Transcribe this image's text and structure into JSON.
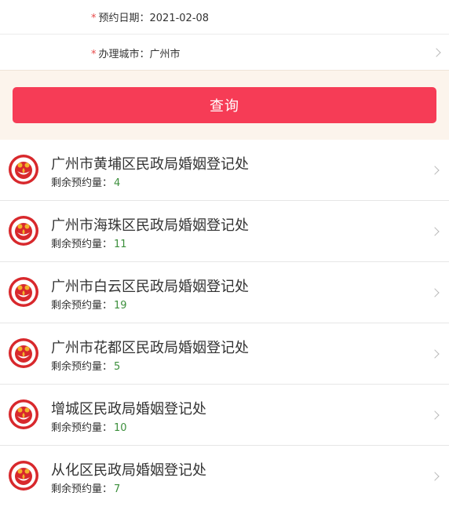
{
  "form": {
    "date_label": "预约日期：",
    "date_value": "2021-02-08",
    "city_label": "办理城市：",
    "city_value": "广州市",
    "required_mark": "*"
  },
  "query_button": {
    "label": "查询"
  },
  "offices": {
    "remaining_label": "剩余预约量：",
    "items": [
      {
        "name": "广州市黄埔区民政局婚姻登记处",
        "remaining": "4"
      },
      {
        "name": "广州市海珠区民政局婚姻登记处",
        "remaining": "11"
      },
      {
        "name": "广州市白云区民政局婚姻登记处",
        "remaining": "19"
      },
      {
        "name": "广州市花都区民政局婚姻登记处",
        "remaining": "5"
      },
      {
        "name": "增城区民政局婚姻登记处",
        "remaining": "10"
      },
      {
        "name": "从化区民政局婚姻登记处",
        "remaining": "7"
      }
    ]
  },
  "colors": {
    "accent": "#f63c56",
    "required": "#e84a4a",
    "count": "#3c8f3c",
    "panel_bg": "#fcf4ec"
  },
  "icons": {
    "logo": "marriage-registry-logo-icon",
    "chevron": "chevron-right-icon"
  }
}
